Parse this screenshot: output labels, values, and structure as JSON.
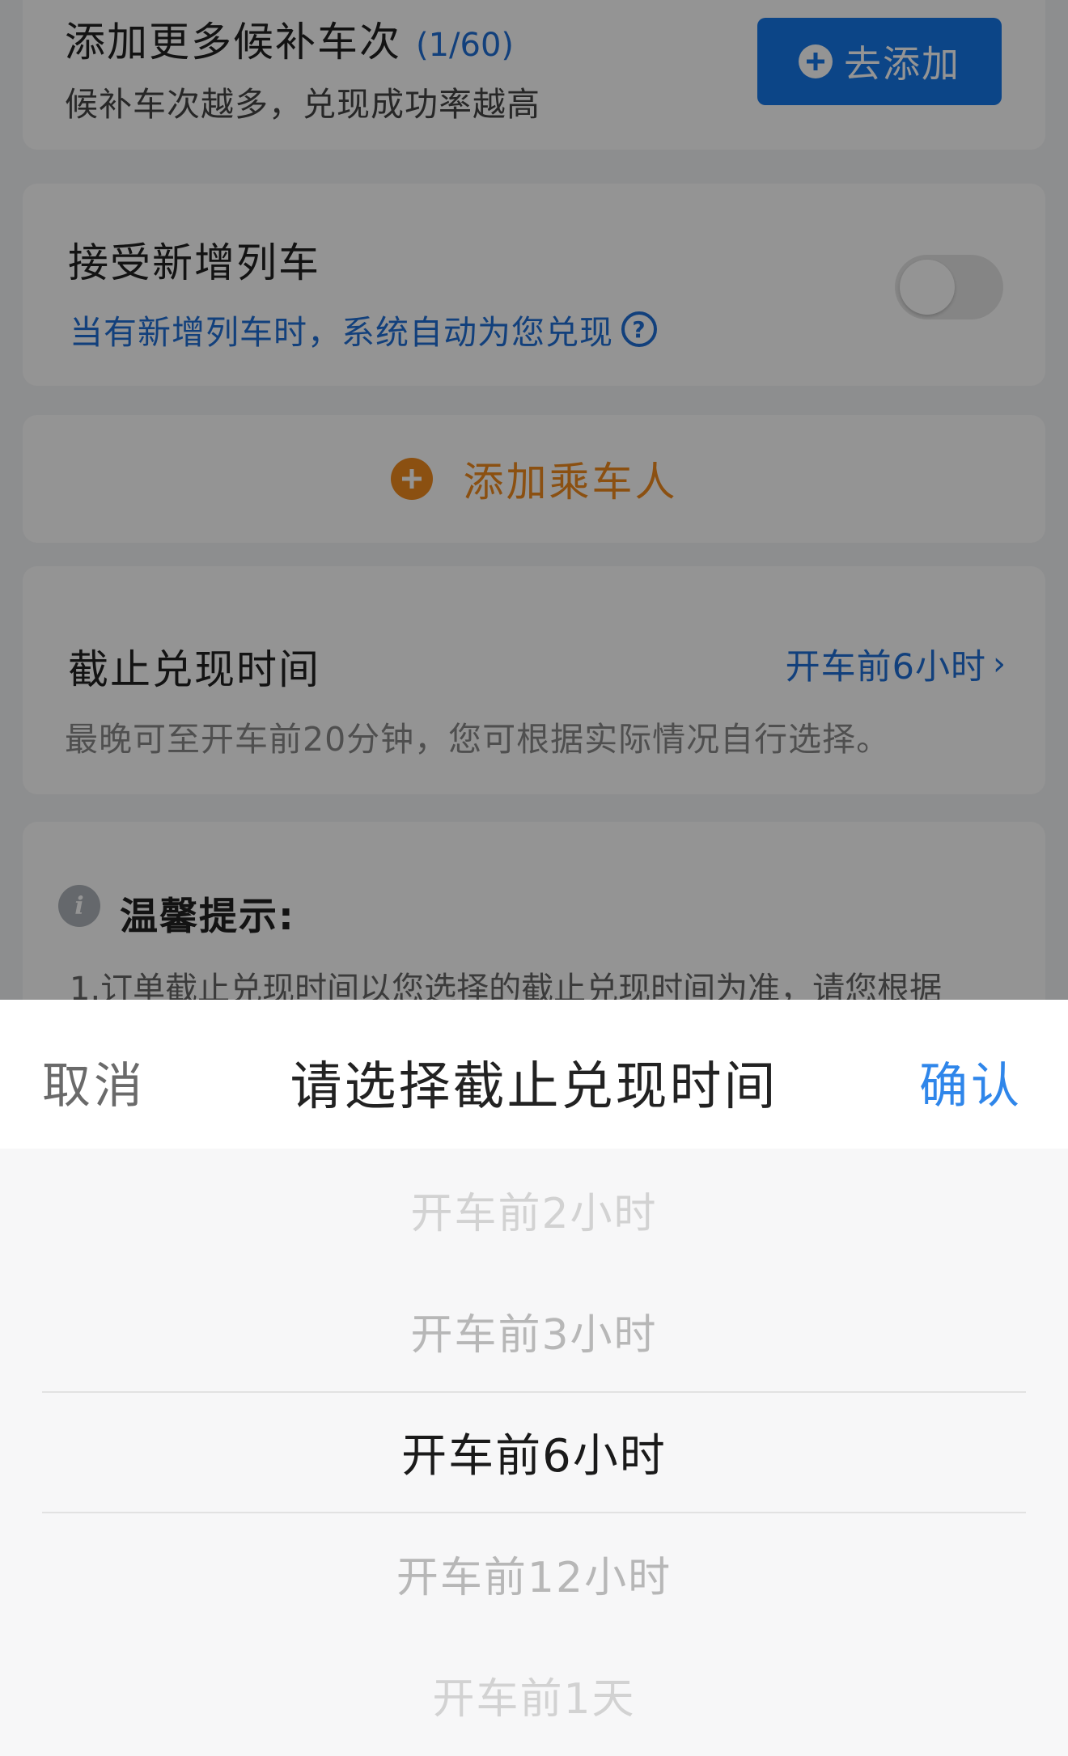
{
  "add_trains": {
    "title": "添加更多候补车次",
    "count": "(1/60)",
    "subtitle": "候补车次越多，兑现成功率越高",
    "button_label": "去添加"
  },
  "new_trains": {
    "title": "接受新增列车",
    "subtitle": "当有新增列车时，系统自动为您兑现",
    "help_icon_glyph": "?",
    "toggle_state": "off"
  },
  "add_passenger": {
    "label": "添加乘车人"
  },
  "deadline": {
    "title": "截止兑现时间",
    "value": "开车前6小时",
    "chevron": "›",
    "note": "最晚可至开车前20分钟，您可根据实际情况自行选择。"
  },
  "tips": {
    "icon_glyph": "i",
    "title": "温馨提示:",
    "line1": "1.订单截止兑现时间以您选择的截止兑现时间为准，请您根据"
  },
  "sheet": {
    "cancel_label": "取消",
    "title": "请选择截止兑现时间",
    "confirm_label": "确认",
    "options": [
      "开车前2小时",
      "开车前3小时",
      "开车前6小时",
      "开车前12小时",
      "开车前1天"
    ],
    "selected": "开车前6小时"
  },
  "colors": {
    "accent_blue": "#1677e8",
    "link_blue": "#1f6fd6",
    "orange": "#f08a1e"
  }
}
